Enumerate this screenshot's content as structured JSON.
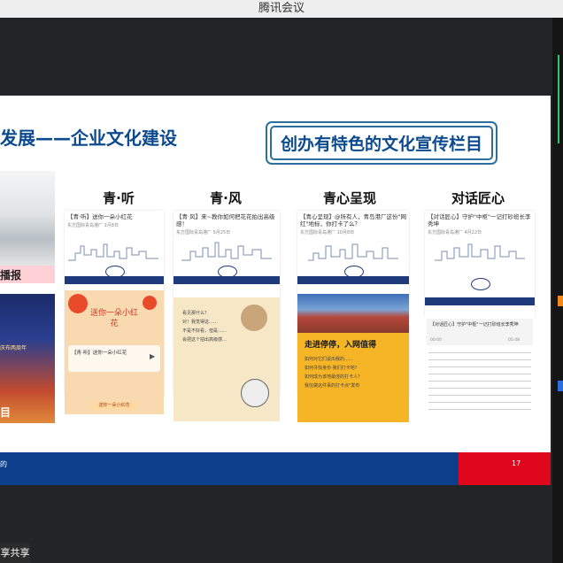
{
  "window": {
    "title": "腾讯会议"
  },
  "slide": {
    "title": "发展——企业文化建设",
    "banner": "创办有特色的文化宣传栏目",
    "left_labels": {
      "top": "播报",
      "bottom": "目",
      "poster": "庆布两周年"
    },
    "page_number": "17",
    "footer_edge": "的",
    "columns": [
      {
        "title": "青·听",
        "article_title": "【青·听】送你一朵小红花",
        "meta": "东方国际青岛港厂  1月8日",
        "bottom_heading": "送你一朵小红花",
        "audio_title": "【青·听】送你一朵小红花",
        "cta": "送你一朵小红花"
      },
      {
        "title": "青·风",
        "article_title": "【青·风】来~教你如何把花花拍出高级感！",
        "meta": "东方国际青岛港厂  5月25日",
        "chat": [
          "看见那什么？",
          "对！我觉得这……",
          "不是不好看，但是……",
          "会把这个拍出高级感…"
        ]
      },
      {
        "title": "青心呈现",
        "article_title": "【青心呈现】@所有人，青岛港厂这份\"网红\"地标，你打卡了么？",
        "meta": "东方国际青岛港厂  10月8日",
        "bottom_heading": "走进停停，入网值得",
        "bottom_lines": [
          "如何对它们说出我的……",
          "如何寻找身份·我们打卡地？",
          "如何成为该地最佳的打卡人？",
          "我在做这件事的打卡点\"发布"
        ]
      },
      {
        "title": "对话匠心",
        "article_title": "【对话匠心】守护\"中枢\"一记打砂班长李秀坤",
        "meta": "东方国际青岛港厂  4月22日",
        "audio_title": "【对话匠心】守护\"中枢\"一记打砂班长李秀坤",
        "audio_time": "00:00",
        "audio_dur": "05:48"
      }
    ]
  },
  "share_button": "享共享",
  "colors": {
    "brand_blue": "#0b4a8f",
    "footer_blue": "#0b3f8c",
    "footer_red": "#e0061b",
    "orange": "#f5a623"
  },
  "icons": [
    "play-icon",
    "logo-icon",
    "flower-icon"
  ]
}
